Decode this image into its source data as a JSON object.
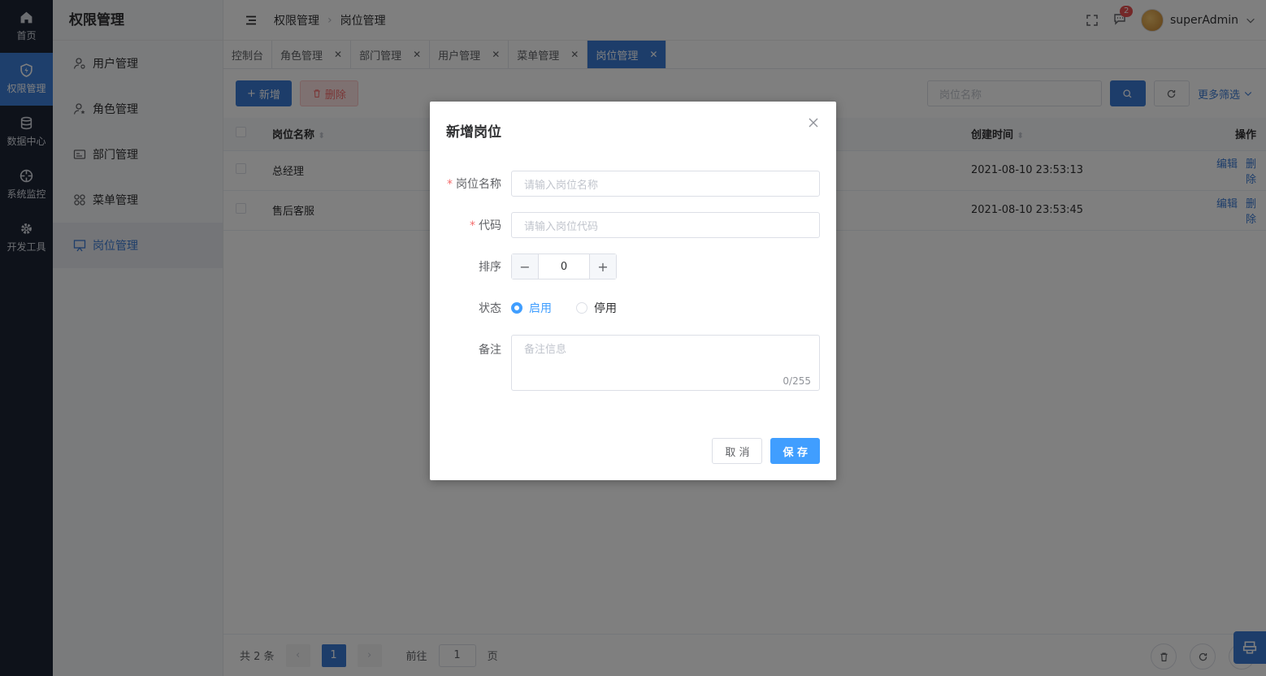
{
  "rail": [
    {
      "label": "首页",
      "icon": "home-icon"
    },
    {
      "label": "权限管理",
      "icon": "shield-icon",
      "active": true
    },
    {
      "label": "数据中心",
      "icon": "database-icon"
    },
    {
      "label": "系统监控",
      "icon": "crosshair-icon"
    },
    {
      "label": "开发工具",
      "icon": "gear-icon"
    }
  ],
  "menu": {
    "title": "权限管理",
    "items": [
      "用户管理",
      "角色管理",
      "部门管理",
      "菜单管理",
      "岗位管理"
    ]
  },
  "header": {
    "crumb1": "权限管理",
    "crumb2": "岗位管理",
    "badge": "2",
    "user": "superAdmin"
  },
  "tabs": [
    "控制台",
    "角色管理",
    "部门管理",
    "用户管理",
    "菜单管理",
    "岗位管理"
  ],
  "toolbar": {
    "add": "新增",
    "delete": "删除",
    "search_placeholder": "岗位名称",
    "more": "更多筛选"
  },
  "table": {
    "col_name": "岗位名称",
    "col_created": "创建时间",
    "col_ops": "操作",
    "edit": "编辑",
    "del": "删除",
    "rows": [
      {
        "name": "总经理",
        "created": "2021-08-10 23:53:13"
      },
      {
        "name": "售后客服",
        "created": "2021-08-10 23:53:45"
      }
    ]
  },
  "pager": {
    "total": "共 2 条",
    "page": "1",
    "goto": "前往",
    "goto_value": "1",
    "page_unit": "页"
  },
  "dialog": {
    "title": "新增岗位",
    "name_label": "岗位名称",
    "name_placeholder": "请输入岗位名称",
    "code_label": "代码",
    "code_placeholder": "请输入岗位代码",
    "sort_label": "排序",
    "sort_value": "0",
    "status_label": "状态",
    "status_on": "启用",
    "status_off": "停用",
    "remark_label": "备注",
    "remark_placeholder": "备注信息",
    "remark_count": "0/255",
    "cancel": "取 消",
    "save": "保 存"
  }
}
